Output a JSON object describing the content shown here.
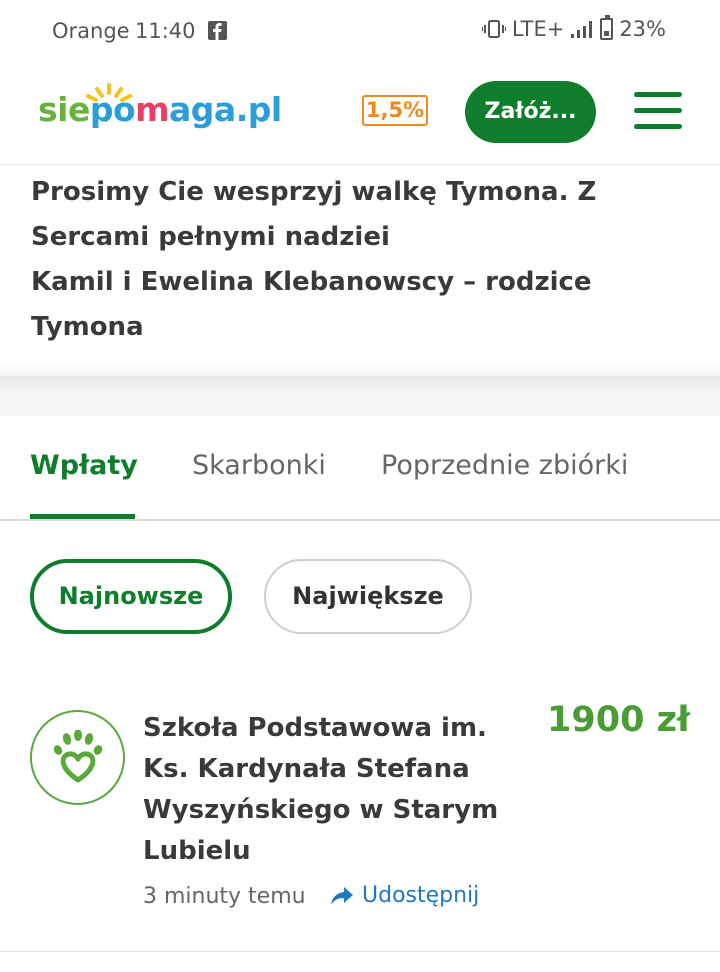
{
  "status_bar": {
    "carrier": "Orange",
    "time": "11:40",
    "network": "LTE+",
    "battery": "23%",
    "icons": [
      "facebook-icon",
      "vibrate-icon",
      "signal-icon",
      "battery-icon"
    ]
  },
  "header": {
    "logo_parts": [
      "sie",
      "po",
      "m",
      "aga.pl"
    ],
    "badge": "1,5%",
    "cta_label": "Załóż...",
    "menu_icon": "hamburger-menu-icon",
    "colors": {
      "brand_green": "#0f7d2b",
      "badge_orange": "#f08a1c"
    }
  },
  "description": {
    "lines": [
      "Prosimy Cie wesprzyj walkę Tymona. Z Sercami pełnymi nadziei",
      "Kamil i Ewelina Klebanowscy – rodzice Tymona"
    ]
  },
  "tabs": [
    {
      "label": "Wpłaty",
      "active": true
    },
    {
      "label": "Skarbonki",
      "active": false
    },
    {
      "label": "Poprzednie zbiórki",
      "active": false
    }
  ],
  "filters": [
    {
      "label": "Najnowsze",
      "selected": true
    },
    {
      "label": "Największe",
      "selected": false
    }
  ],
  "donations": [
    {
      "donor": "Szkoła Podstawowa im. Ks. Kardynała Stefana Wyszyńskiego w Starym Lubielu",
      "amount": "1900 zł",
      "time": "3 minuty temu",
      "share_label": "Udostępnij",
      "avatar_icon": "hand-heart-icon",
      "share_icon": "share-arrow-icon"
    }
  ]
}
